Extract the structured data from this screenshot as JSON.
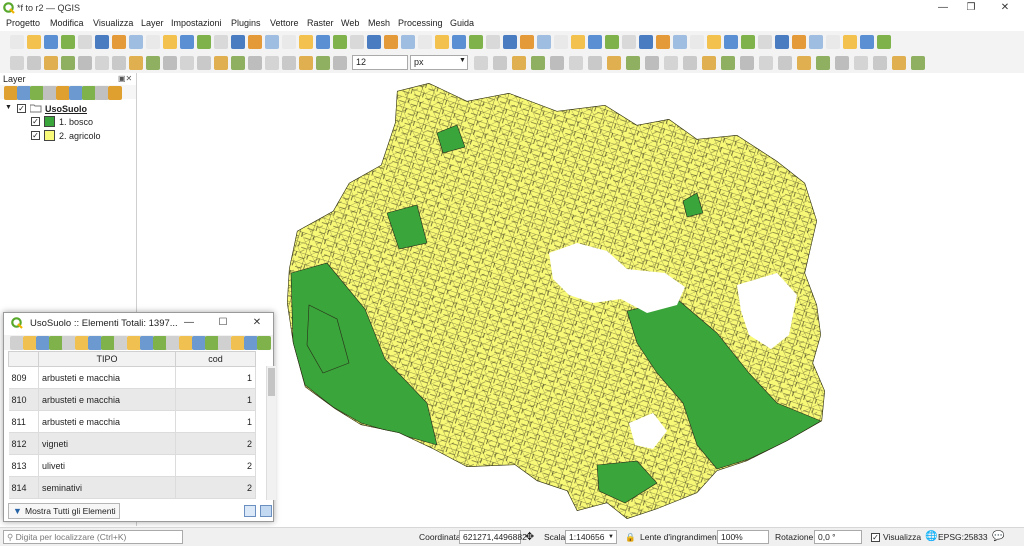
{
  "window": {
    "title": "*f to r2 — QGIS",
    "controls": {
      "minimize": "—",
      "restore": "❐",
      "close": "✕"
    }
  },
  "menu": [
    "Progetto",
    "Modifica",
    "Visualizza",
    "Layer",
    "Impostazioni",
    "Plugins",
    "Vettore",
    "Raster",
    "Web",
    "Mesh",
    "Processing",
    "Guida"
  ],
  "toolbar2": {
    "snap_tolerance": "12",
    "snap_units": "px"
  },
  "layers_panel": {
    "title": "Layer",
    "group": {
      "name": "UsoSuolo",
      "checked": true
    },
    "classes": [
      {
        "label": "1. bosco",
        "color": "#3aa53a",
        "checked": true
      },
      {
        "label": "2. agricolo",
        "color": "#fafa7a",
        "checked": true
      }
    ]
  },
  "map": {
    "colors": {
      "bosco": "#3aa53a",
      "agricolo": "#f8f877",
      "outline": "#2a2a1a"
    }
  },
  "attribute_table": {
    "title": "UsoSuolo :: Elementi Totali: 1397...",
    "columns": [
      "TIPO",
      "cod"
    ],
    "rows": [
      {
        "id": "809",
        "tipo": "arbusteti e macchia",
        "cod": "1"
      },
      {
        "id": "810",
        "tipo": "arbusteti e macchia",
        "cod": "1"
      },
      {
        "id": "811",
        "tipo": "arbusteti e macchia",
        "cod": "1"
      },
      {
        "id": "812",
        "tipo": "vigneti",
        "cod": "2"
      },
      {
        "id": "813",
        "tipo": "uliveti",
        "cod": "2"
      },
      {
        "id": "814",
        "tipo": "seminativi",
        "cod": "2"
      }
    ],
    "show_all_label": "Mostra Tutti gli Elementi"
  },
  "statusbar": {
    "locator_placeholder": "Digita per localizzare (Ctrl+K)",
    "coord_label": "Coordinata",
    "coord_value": "621271,4496882",
    "scale_label": "Scala",
    "scale_value": "1:140656",
    "magnifier_label": "Lente d'ingrandimento",
    "magnifier_value": "100%",
    "rotation_label": "Rotazione",
    "rotation_value": "0,0 °",
    "render_label": "Visualizza",
    "crs": "EPSG:25833"
  }
}
